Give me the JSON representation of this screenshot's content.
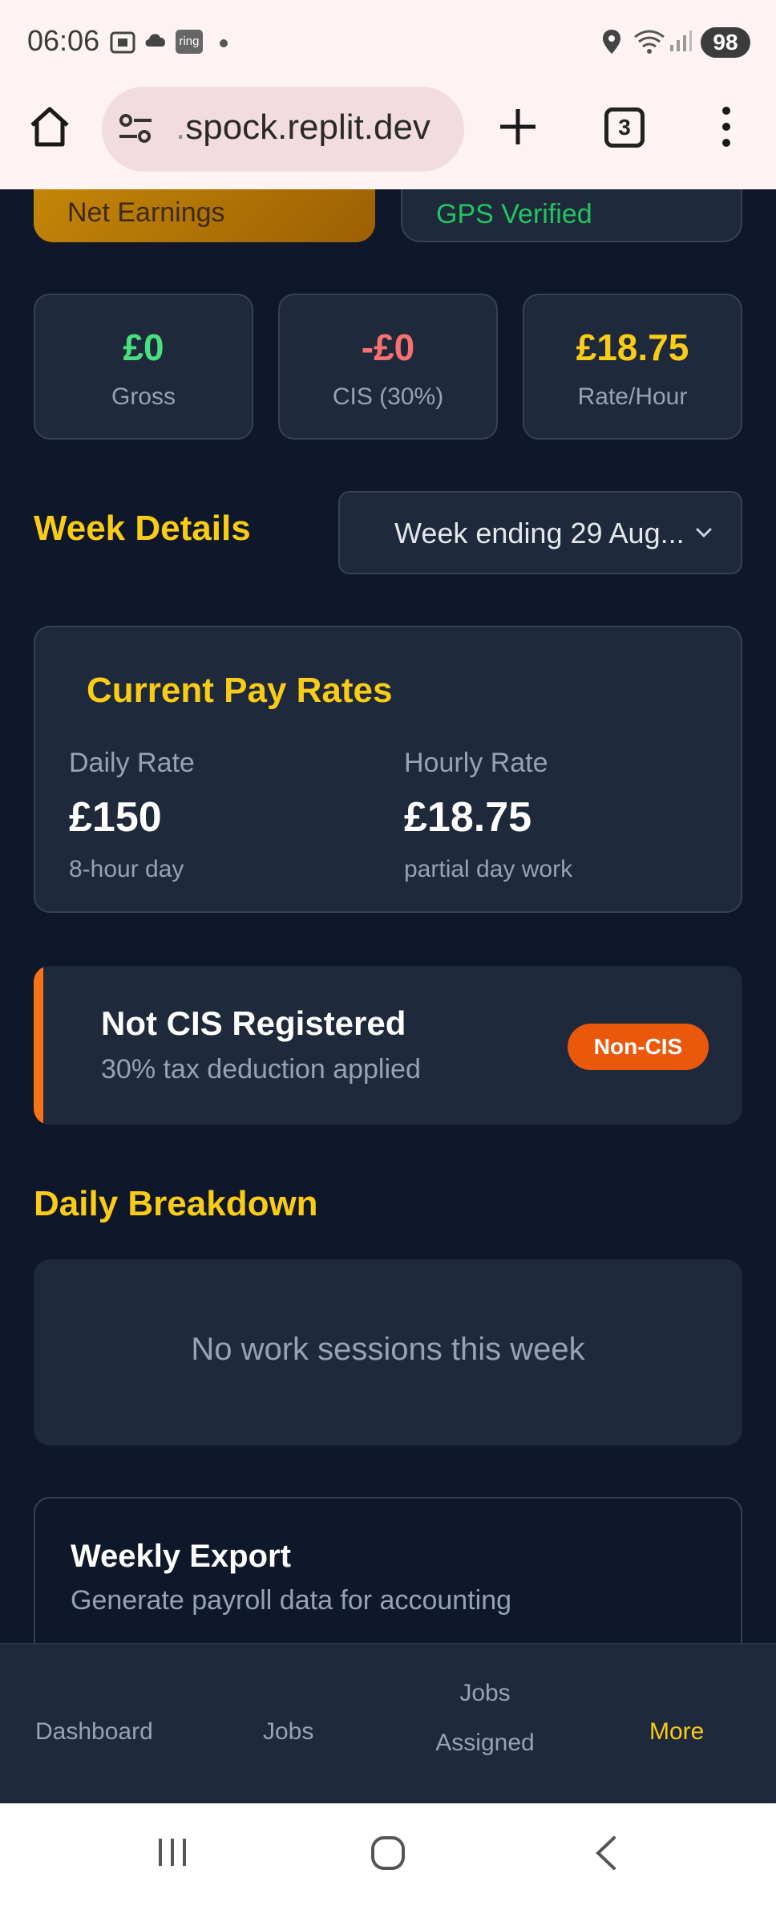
{
  "status_bar": {
    "time": "06:06",
    "ring_badge": "ring",
    "battery": "98"
  },
  "browser": {
    "url_prefix": ".",
    "url": "spock.replit.dev",
    "tab_count": "3"
  },
  "summary": {
    "net_label": "Net Earnings",
    "gps_label": "GPS Verified"
  },
  "stats": [
    {
      "value": "£0",
      "label": "Gross",
      "color": "#4ade80"
    },
    {
      "value": "-£0",
      "label": "CIS (30%)",
      "color": "#f87171"
    },
    {
      "value": "£18.75",
      "label": "Rate/Hour",
      "color": "#facc15"
    }
  ],
  "week_details": {
    "title": "Week Details",
    "selected_week": "Week ending 29 Aug..."
  },
  "pay_rates": {
    "title": "Current Pay Rates",
    "daily": {
      "label": "Daily Rate",
      "value": "£150",
      "note": "8-hour day"
    },
    "hourly": {
      "label": "Hourly Rate",
      "value": "£18.75",
      "note": "partial day work"
    }
  },
  "cis_status": {
    "title": "Not CIS Registered",
    "subtitle": "30% tax deduction applied",
    "badge": "Non-CIS"
  },
  "daily_breakdown": {
    "title": "Daily Breakdown",
    "empty_message": "No work sessions this week"
  },
  "weekly_export": {
    "title": "Weekly Export",
    "subtitle": "Generate payroll data for accounting"
  },
  "bottom_nav": {
    "items": [
      {
        "label": "Dashboard"
      },
      {
        "label": "Jobs"
      },
      {
        "label_line1": "Jobs",
        "label_line2": "Assigned"
      },
      {
        "label": "More"
      }
    ],
    "active_color": "#facc15"
  },
  "colors": {
    "accent": "#facc15",
    "background": "#0f172a",
    "card": "#1e293b",
    "warning": "#f97316"
  }
}
